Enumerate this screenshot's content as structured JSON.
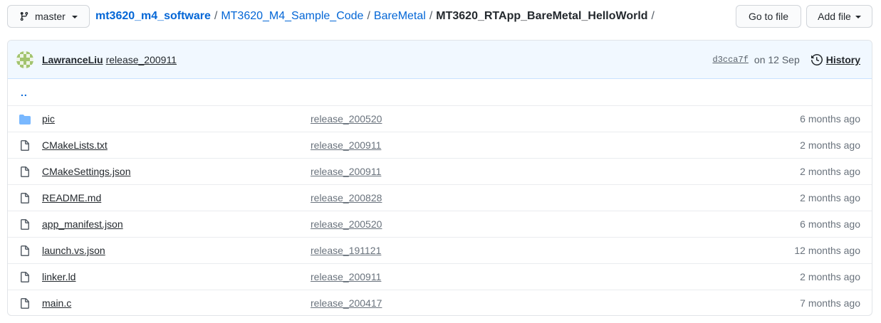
{
  "branch": {
    "name": "master"
  },
  "breadcrumb": [
    {
      "label": "mt3620_m4_software",
      "kind": "repo"
    },
    {
      "label": "MT3620_M4_Sample_Code",
      "kind": "dir"
    },
    {
      "label": "BareMetal",
      "kind": "dir"
    },
    {
      "label": "MT3620_RTApp_BareMetal_HelloWorld",
      "kind": "current"
    }
  ],
  "breadcrumb_sep": "/",
  "actions": {
    "go_to_file": "Go to file",
    "add_file": "Add file"
  },
  "commit": {
    "author": "LawranceLiu",
    "message": "release_200911",
    "sha": "d3cca7f",
    "date": "on 12 Sep",
    "history_label": "History"
  },
  "parent_dir": "..",
  "files": [
    {
      "name": "pic",
      "type": "dir",
      "message": "release_200520",
      "age": "6 months ago"
    },
    {
      "name": "CMakeLists.txt",
      "type": "file",
      "message": "release_200911",
      "age": "2 months ago"
    },
    {
      "name": "CMakeSettings.json",
      "type": "file",
      "message": "release_200911",
      "age": "2 months ago"
    },
    {
      "name": "README.md",
      "type": "file",
      "message": "release_200828",
      "age": "2 months ago"
    },
    {
      "name": "app_manifest.json",
      "type": "file",
      "message": "release_200520",
      "age": "6 months ago"
    },
    {
      "name": "launch.vs.json",
      "type": "file",
      "message": "release_191121",
      "age": "12 months ago"
    },
    {
      "name": "linker.ld",
      "type": "file",
      "message": "release_200911",
      "age": "2 months ago"
    },
    {
      "name": "main.c",
      "type": "file",
      "message": "release_200417",
      "age": "7 months ago"
    }
  ],
  "colors": {
    "link": "#0366d6",
    "folder": "#79b8ff",
    "commit_bar": "#f1f8ff",
    "avatar": "#a3c46f"
  }
}
